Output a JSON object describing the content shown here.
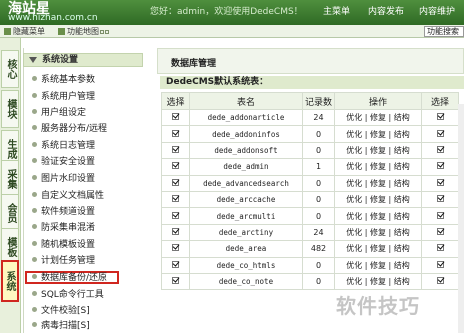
{
  "header": {
    "logo": "海站星",
    "url": "www.hizhan.com.cn",
    "user_text": "您好：admin，欢迎使用DedeCMS！",
    "nav": [
      "主菜单",
      "内容发布",
      "内容维护"
    ]
  },
  "toolbar": {
    "hide_menu": "隐藏菜单",
    "func_map": "功能地图",
    "func_search": "功能搜索"
  },
  "sidebar": {
    "tabs": [
      "核心",
      "模块",
      "生成",
      "采集",
      "会员",
      "模板",
      "系统"
    ]
  },
  "menu": {
    "heading": "系统设置",
    "items": [
      "系统基本参数",
      "系统用户管理",
      "用户组设定",
      "服务器分布/远程",
      "系统日志管理",
      "验证安全设置",
      "图片水印设置",
      "自定义文档属性",
      "软件频道设置",
      "防采集串混淆",
      "随机模板设置",
      "计划任务管理",
      "数据库备份/还原",
      "SQL命令行工具",
      "文件校验[S]",
      "病毒扫描[S]"
    ]
  },
  "main": {
    "title": "数据库管理",
    "subtitle": "DedeCMS默认系统表：",
    "headers": [
      "选择",
      "表名",
      "记录数",
      "操作",
      "选择"
    ],
    "ops": [
      "优化",
      "修复",
      "结构"
    ],
    "rows": [
      {
        "name": "dede_addonarticle",
        "count": "24"
      },
      {
        "name": "dede_addoninfos",
        "count": "0"
      },
      {
        "name": "dede_addonsoft",
        "count": "0"
      },
      {
        "name": "dede_admin",
        "count": "1"
      },
      {
        "name": "dede_advancedsearch",
        "count": "0"
      },
      {
        "name": "dede_arccache",
        "count": "0"
      },
      {
        "name": "dede_arcmulti",
        "count": "0"
      },
      {
        "name": "dede_arctiny",
        "count": "24"
      },
      {
        "name": "dede_area",
        "count": "482"
      },
      {
        "name": "dede_co_htmls",
        "count": "0"
      },
      {
        "name": "dede_co_note",
        "count": "0"
      }
    ]
  },
  "watermark": "软件技巧"
}
